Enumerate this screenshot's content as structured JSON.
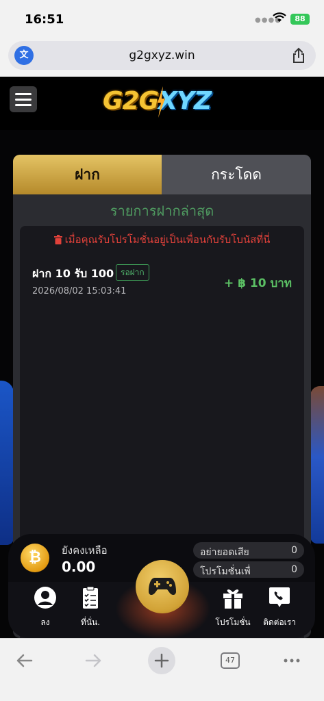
{
  "status": {
    "time": "16:51",
    "battery": "88"
  },
  "browser": {
    "url": "g2gxyz.win",
    "tabs_count": "47"
  },
  "site": {
    "logo_part1": "G2G",
    "logo_part2": "XYZ",
    "tabs": [
      {
        "label": "ฝาก"
      },
      {
        "label": "กระโดด"
      }
    ],
    "list_title": "รายการฝากล่าสุด",
    "warning": "เมื่อคุณรับโปรโมชั่นอยู่เป็นเพื่อนกับรับโบนัสที่นี่",
    "transactions": [
      {
        "title": "ฝาก 10 รับ 100",
        "status": "รอฝาก",
        "date": "2026/08/02 15:03:41",
        "amount": "+ ฿ 10 บาท"
      }
    ],
    "balance": {
      "label": "ยังคงเหลือ",
      "value": "0.00"
    },
    "stats": [
      {
        "label": "อย่ายอดเสีย",
        "value": "0"
      },
      {
        "label": "โปรโมชั่นเพื่",
        "value": "0"
      }
    ],
    "nav": [
      {
        "label": "ลง",
        "icon": "user-icon"
      },
      {
        "label": "ที่นั่น.",
        "icon": "checklist-icon"
      },
      {
        "label": "โปรโมชั่น",
        "icon": "gift-icon"
      },
      {
        "label": "ติดต่อเรา",
        "icon": "phone-chat-icon"
      }
    ],
    "accent": "#d9ae42",
    "status_green": "#4fb06a",
    "warning_red": "#e0413a"
  }
}
